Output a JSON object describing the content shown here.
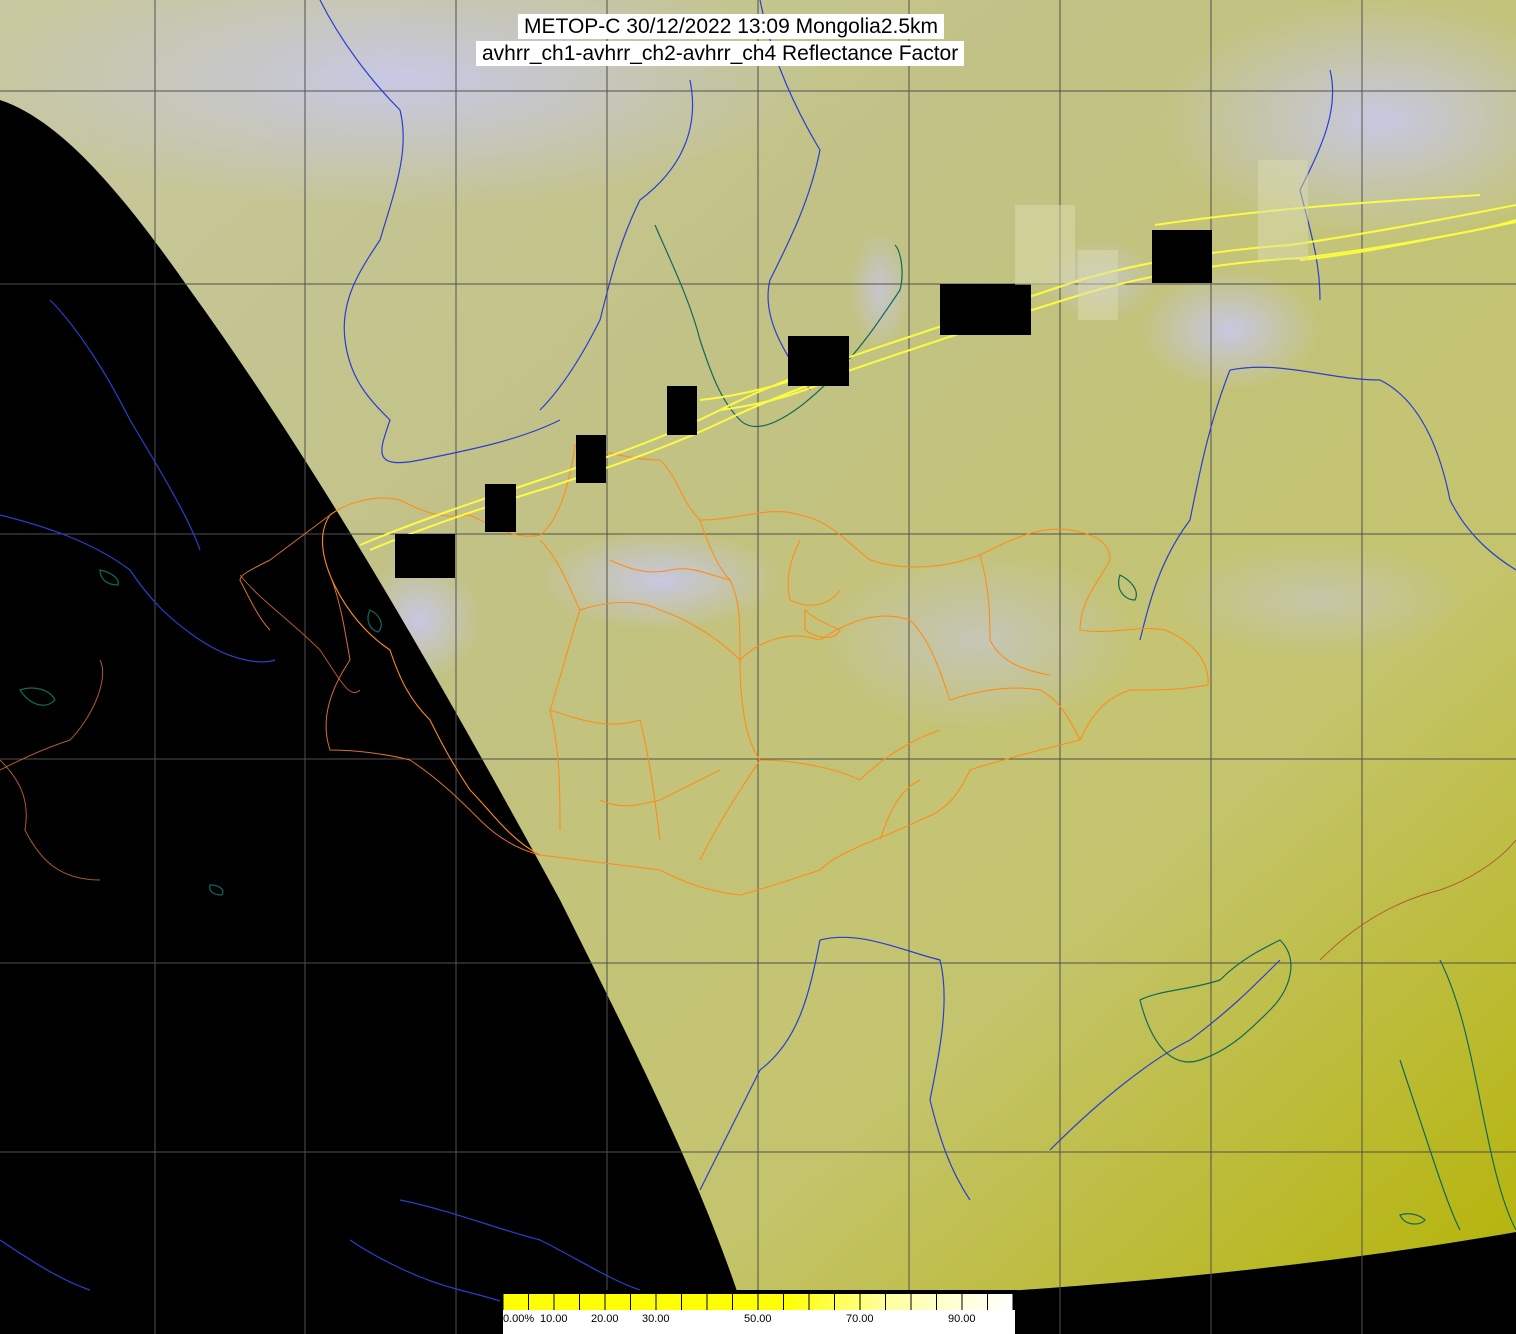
{
  "title": {
    "line1": "METOP-C 30/12/2022 13:09 Mongolia2.5km",
    "line2": "avhrr_ch1-avhrr_ch2-avhrr_ch4 Reflectance Factor"
  },
  "colors": {
    "no_data": "#000000",
    "surface_low": "#b9b820",
    "surface_mid": "#c7c77a",
    "cloud": "#c6c6e6",
    "grid": "#505050",
    "rivers": "#2a3fcf",
    "lakes_coast": "#0f6a5a",
    "mongolia_borders": "#ff8c1a",
    "country_borders": "#b05a30",
    "scan_artifact": "#ffff40"
  },
  "colorbar": {
    "labels": [
      "0.00%",
      "10.00",
      "20.00",
      "30.00",
      "50.00",
      "70.00",
      "90.00"
    ],
    "stops": [
      0.0,
      0.1,
      0.2,
      0.3,
      0.5,
      0.7,
      0.9
    ],
    "color_low": "#ffff00",
    "color_high": "#ffffff"
  }
}
